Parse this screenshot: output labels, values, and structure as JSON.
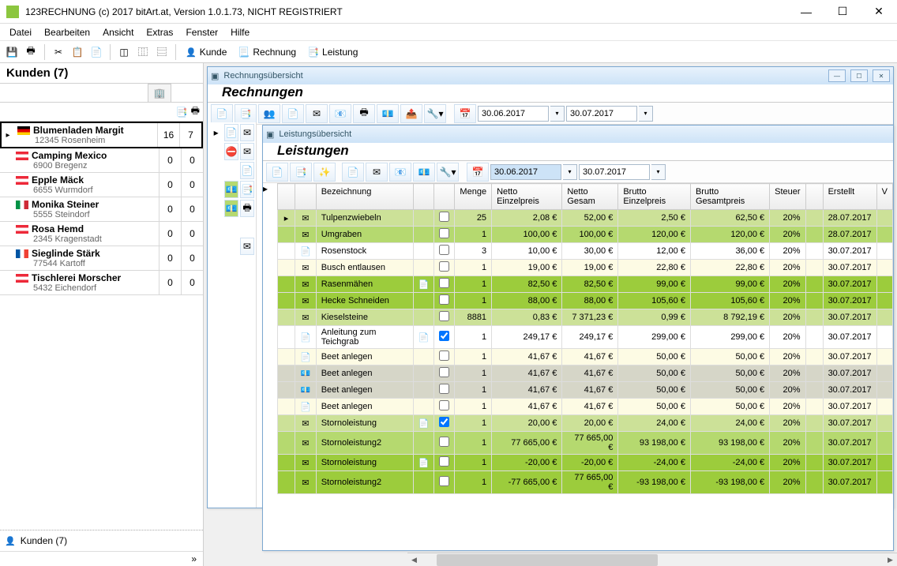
{
  "app": {
    "title": "123RECHNUNG (c) 2017 bitArt.at, Version 1.0.1.73, NICHT REGISTRIERT"
  },
  "menus": [
    "Datei",
    "Bearbeiten",
    "Ansicht",
    "Extras",
    "Fenster",
    "Hilfe"
  ],
  "toolbar_labels": {
    "kunde": "Kunde",
    "rechnung": "Rechnung",
    "leistung": "Leistung"
  },
  "customers": {
    "header": "Kunden (7)",
    "footer": "Kunden (7)",
    "items": [
      {
        "flag": "de",
        "name": "Blumenladen Margit",
        "sub": "12345 Rosenheim",
        "c1": "16",
        "c2": "7",
        "selected": true
      },
      {
        "flag": "at",
        "name": "Camping Mexico",
        "sub": "6900 Bregenz",
        "c1": "0",
        "c2": "0"
      },
      {
        "flag": "at",
        "name": "Epple Mäck",
        "sub": "6655 Wurmdorf",
        "c1": "0",
        "c2": "0"
      },
      {
        "flag": "it",
        "name": "Monika Steiner",
        "sub": "5555 Steindorf",
        "c1": "0",
        "c2": "0"
      },
      {
        "flag": "at",
        "name": "Rosa Hemd",
        "sub": "2345 Kragenstadt",
        "c1": "0",
        "c2": "0"
      },
      {
        "flag": "fr",
        "name": "Sieglinde Stärk",
        "sub": "77544 Kartoff",
        "c1": "0",
        "c2": "0"
      },
      {
        "flag": "at",
        "name": "Tischlerei Morscher",
        "sub": "5432 Eichendorf",
        "c1": "0",
        "c2": "0"
      }
    ]
  },
  "rechnung": {
    "title": "Rechnungsübersicht",
    "heading": "Rechnungen",
    "date_from": "30.06.2017",
    "date_to": "30.07.2017"
  },
  "leistung": {
    "title": "Leistungsübersicht",
    "heading": "Leistungen",
    "date_from": "30.06.2017",
    "date_to": "30.07.2017",
    "columns": [
      "",
      "",
      "Bezeichnung",
      "",
      "",
      "Menge",
      "Netto Einzelpreis",
      "Netto Gesam",
      "Brutto Einzelpreis",
      "Brutto Gesamtpreis",
      "Steuer",
      "",
      "Erstellt",
      "V"
    ],
    "rows": [
      {
        "cls": "row-green1",
        "ico": "mail",
        "name": "Tulpenzwiebeln",
        "doc": "",
        "chk": false,
        "menge": "25",
        "ne": "2,08 €",
        "ng": "52,00 €",
        "be": "2,50 €",
        "bg": "62,50 €",
        "st": "20%",
        "er": "28.07.2017",
        "sel": true
      },
      {
        "cls": "row-green2",
        "ico": "mail",
        "name": "Umgraben",
        "doc": "",
        "chk": false,
        "menge": "1",
        "ne": "100,00 €",
        "ng": "100,00 €",
        "be": "120,00 €",
        "bg": "120,00 €",
        "st": "20%",
        "er": "28.07.2017"
      },
      {
        "cls": "row-white",
        "ico": "doc",
        "name": "Rosenstock",
        "doc": "",
        "chk": false,
        "menge": "3",
        "ne": "10,00 €",
        "ng": "30,00 €",
        "be": "12,00 €",
        "bg": "36,00 €",
        "st": "20%",
        "er": "30.07.2017"
      },
      {
        "cls": "row-yellow",
        "ico": "mail",
        "name": "Busch entlausen",
        "doc": "",
        "chk": false,
        "menge": "1",
        "ne": "19,00 €",
        "ng": "19,00 €",
        "be": "22,80 €",
        "bg": "22,80 €",
        "st": "20%",
        "er": "30.07.2017"
      },
      {
        "cls": "row-green3",
        "ico": "mail",
        "name": "Rasenmähen",
        "doc": "📄",
        "chk": false,
        "menge": "1",
        "ne": "82,50 €",
        "ng": "82,50 €",
        "be": "99,00 €",
        "bg": "99,00 €",
        "st": "20%",
        "er": "30.07.2017"
      },
      {
        "cls": "row-green3",
        "ico": "mail",
        "name": "Hecke Schneiden",
        "doc": "",
        "chk": false,
        "menge": "1",
        "ne": "88,00 €",
        "ng": "88,00 €",
        "be": "105,60 €",
        "bg": "105,60 €",
        "st": "20%",
        "er": "30.07.2017"
      },
      {
        "cls": "row-green1",
        "ico": "mail",
        "name": "Kieselsteine",
        "doc": "",
        "chk": false,
        "menge": "8881",
        "ne": "0,83 €",
        "ng": "7 371,23 €",
        "be": "0,99 €",
        "bg": "8 792,19 €",
        "st": "20%",
        "er": "30.07.2017"
      },
      {
        "cls": "row-white",
        "ico": "doc",
        "name": "Anleitung zum Teichgrab",
        "doc": "📄",
        "chk": true,
        "menge": "1",
        "ne": "249,17 €",
        "ng": "249,17 €",
        "be": "299,00 €",
        "bg": "299,00 €",
        "st": "20%",
        "er": "30.07.2017"
      },
      {
        "cls": "row-yellow",
        "ico": "doc",
        "name": "Beet anlegen",
        "doc": "",
        "chk": false,
        "menge": "1",
        "ne": "41,67 €",
        "ng": "41,67 €",
        "be": "50,00 €",
        "bg": "50,00 €",
        "st": "20%",
        "er": "30.07.2017"
      },
      {
        "cls": "row-gray",
        "ico": "money",
        "name": "Beet anlegen",
        "doc": "",
        "chk": false,
        "menge": "1",
        "ne": "41,67 €",
        "ng": "41,67 €",
        "be": "50,00 €",
        "bg": "50,00 €",
        "st": "20%",
        "er": "30.07.2017"
      },
      {
        "cls": "row-gray",
        "ico": "money",
        "name": "Beet anlegen",
        "doc": "",
        "chk": false,
        "menge": "1",
        "ne": "41,67 €",
        "ng": "41,67 €",
        "be": "50,00 €",
        "bg": "50,00 €",
        "st": "20%",
        "er": "30.07.2017"
      },
      {
        "cls": "row-yellow",
        "ico": "doc",
        "name": "Beet anlegen",
        "doc": "",
        "chk": false,
        "menge": "1",
        "ne": "41,67 €",
        "ng": "41,67 €",
        "be": "50,00 €",
        "bg": "50,00 €",
        "st": "20%",
        "er": "30.07.2017"
      },
      {
        "cls": "row-green1",
        "ico": "mail",
        "name": "Stornoleistung",
        "doc": "📄",
        "chk": true,
        "menge": "1",
        "ne": "20,00 €",
        "ng": "20,00 €",
        "be": "24,00 €",
        "bg": "24,00 €",
        "st": "20%",
        "er": "30.07.2017"
      },
      {
        "cls": "row-green2",
        "ico": "mail",
        "name": "Stornoleistung2",
        "doc": "",
        "chk": false,
        "menge": "1",
        "ne": "77 665,00 €",
        "ng": "77 665,00 €",
        "be": "93 198,00 €",
        "bg": "93 198,00 €",
        "st": "20%",
        "er": "30.07.2017"
      },
      {
        "cls": "row-green3",
        "ico": "mail",
        "name": "Stornoleistung",
        "doc": "📄",
        "chk": false,
        "menge": "1",
        "ne": "-20,00 €",
        "ng": "-20,00 €",
        "be": "-24,00 €",
        "bg": "-24,00 €",
        "st": "20%",
        "er": "30.07.2017"
      },
      {
        "cls": "row-green3",
        "ico": "mail",
        "name": "Stornoleistung2",
        "doc": "",
        "chk": false,
        "menge": "1",
        "ne": "-77 665,00 €",
        "ng": "77 665,00 €",
        "be": "-93 198,00 €",
        "bg": "-93 198,00 €",
        "st": "20%",
        "er": "30.07.2017"
      }
    ]
  }
}
